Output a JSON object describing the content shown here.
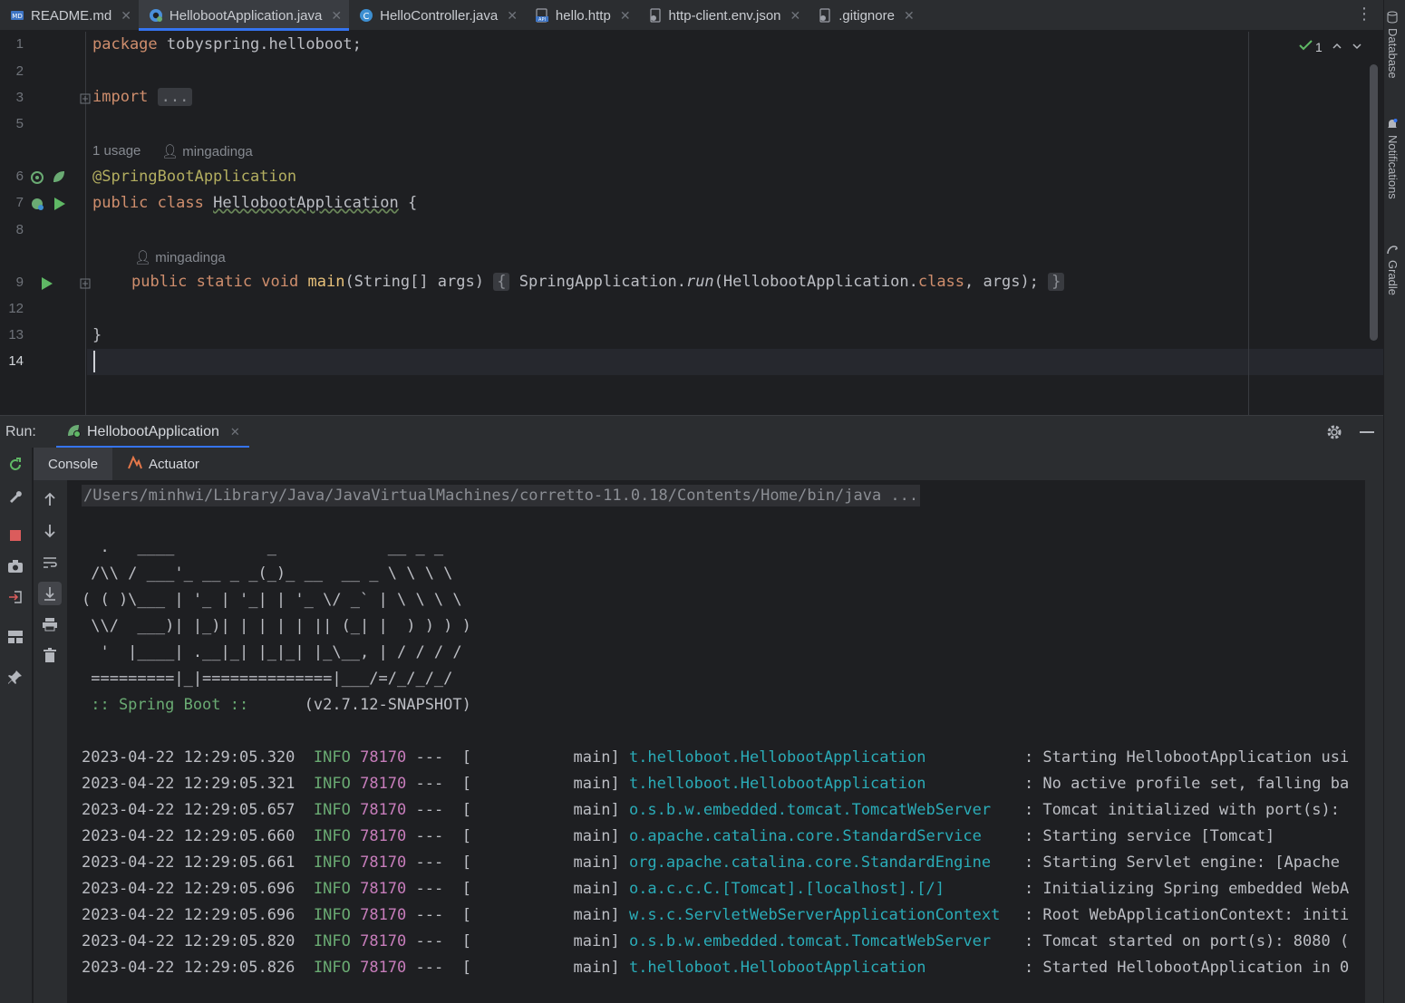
{
  "tabs": [
    {
      "label": "README.md",
      "icon": "markdown-icon",
      "active": false
    },
    {
      "label": "HellobootApplication.java",
      "icon": "spring-boot-icon",
      "active": true
    },
    {
      "label": "HelloController.java",
      "icon": "class-icon",
      "active": false
    },
    {
      "label": "hello.http",
      "icon": "api-file-icon",
      "active": false
    },
    {
      "label": "http-client.env.json",
      "icon": "json-file-icon",
      "active": false
    },
    {
      "label": ".gitignore",
      "icon": "gitignore-file-icon",
      "active": false
    }
  ],
  "editor": {
    "line_numbers": [
      "1",
      "2",
      "3",
      "5",
      "6",
      "7",
      "8",
      "9",
      "12",
      "13",
      "14"
    ],
    "current_line": "14",
    "inspection_count": "1",
    "hints": {
      "usages": "1 usage",
      "author1": "mingadinga",
      "author2": "mingadinga"
    },
    "code": {
      "line1_kw": "package",
      "line1_rest": " tobyspring.helloboot;",
      "line3_kw": "import",
      "line3_fold": "...",
      "line6_ann": "@SpringBootApplication",
      "line7_kw": "public class",
      "line7_name": "HellobootApplication",
      "line7_rest": " {",
      "line9_kw": "public static void",
      "line9_method": "main",
      "line9_params": "(String[] args)",
      "line9_open": "{",
      "line9_call1": "SpringApplication.",
      "line9_call2": "run",
      "line9_call3": "(HellobootApplication.",
      "line9_class": "class",
      "line9_call4": ", args);",
      "line9_close": "}",
      "line13": "}"
    }
  },
  "run": {
    "label": "Run:",
    "tab_label": "HellobootApplication",
    "subtabs": [
      "Console",
      "Actuator"
    ]
  },
  "console": {
    "command": "/Users/minhwi/Library/Java/JavaVirtualMachines/corretto-11.0.18/Contents/Home/bin/java ...",
    "banner": [
      "  .   ____          _            __ _ _",
      " /\\\\ / ___'_ __ _ _(_)_ __  __ _ \\ \\ \\ \\",
      "( ( )\\___ | '_ | '_| | '_ \\/ _` | \\ \\ \\ \\",
      " \\\\/  ___)| |_)| | | | | || (_| |  ) ) ) )",
      "  '  |____| .__|_| |_|_| |_\\__, | / / / /",
      " =========|_|==============|___/=/_/_/_/"
    ],
    "boot_label": " :: Spring Boot :: ",
    "boot_version": "     (v2.7.12-SNAPSHOT)",
    "logs": [
      {
        "ts": "2023-04-22 12:29:05.320",
        "level": "INFO",
        "pid": "78170",
        "thread": "---  [           main]",
        "logger": "t.helloboot.HellobootApplication",
        "msg": ": Starting HellobootApplication usi"
      },
      {
        "ts": "2023-04-22 12:29:05.321",
        "level": "INFO",
        "pid": "78170",
        "thread": "---  [           main]",
        "logger": "t.helloboot.HellobootApplication",
        "msg": ": No active profile set, falling ba"
      },
      {
        "ts": "2023-04-22 12:29:05.657",
        "level": "INFO",
        "pid": "78170",
        "thread": "---  [           main]",
        "logger": "o.s.b.w.embedded.tomcat.TomcatWebServer",
        "msg": ": Tomcat initialized with port(s):"
      },
      {
        "ts": "2023-04-22 12:29:05.660",
        "level": "INFO",
        "pid": "78170",
        "thread": "---  [           main]",
        "logger": "o.apache.catalina.core.StandardService",
        "msg": ": Starting service [Tomcat]"
      },
      {
        "ts": "2023-04-22 12:29:05.661",
        "level": "INFO",
        "pid": "78170",
        "thread": "---  [           main]",
        "logger": "org.apache.catalina.core.StandardEngine",
        "msg": ": Starting Servlet engine: [Apache"
      },
      {
        "ts": "2023-04-22 12:29:05.696",
        "level": "INFO",
        "pid": "78170",
        "thread": "---  [           main]",
        "logger": "o.a.c.c.C.[Tomcat].[localhost].[/]",
        "msg": ": Initializing Spring embedded WebA"
      },
      {
        "ts": "2023-04-22 12:29:05.696",
        "level": "INFO",
        "pid": "78170",
        "thread": "---  [           main]",
        "logger": "w.s.c.ServletWebServerApplicationContext",
        "msg": ": Root WebApplicationContext: initi"
      },
      {
        "ts": "2023-04-22 12:29:05.820",
        "level": "INFO",
        "pid": "78170",
        "thread": "---  [           main]",
        "logger": "o.s.b.w.embedded.tomcat.TomcatWebServer",
        "msg": ": Tomcat started on port(s): 8080 ("
      },
      {
        "ts": "2023-04-22 12:29:05.826",
        "level": "INFO",
        "pid": "78170",
        "thread": "---  [           main]",
        "logger": "t.helloboot.HellobootApplication",
        "msg": ": Started HellobootApplication in 0"
      }
    ]
  },
  "right_stripe": [
    "Database",
    "Notifications",
    "Gradle"
  ],
  "colors": {
    "accent": "#3574f0",
    "keyword": "#cf8e6d",
    "annotation": "#b3ae60",
    "logger": "#2aacb8",
    "info": "#6aab73",
    "pid": "#c77dbb"
  }
}
